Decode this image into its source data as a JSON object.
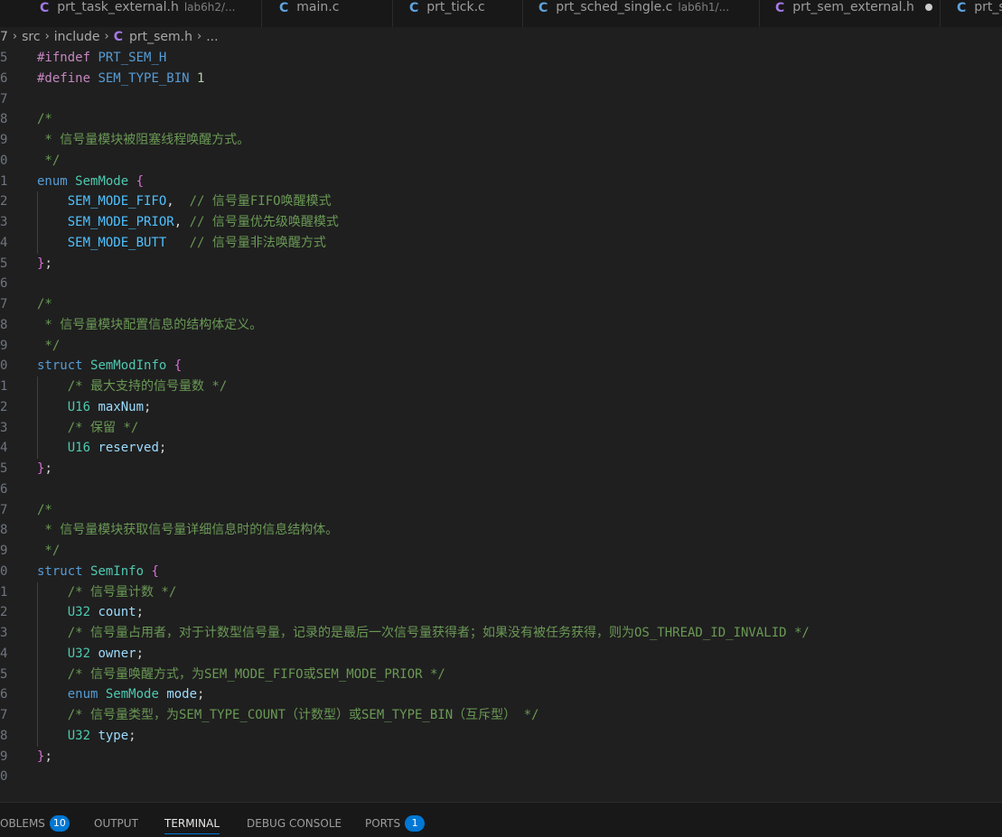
{
  "tabs": [
    {
      "icon": "C",
      "name": "prt_task_external.h",
      "desc": "lab6h2/...",
      "active": false
    },
    {
      "icon": "C",
      "name": "main.c",
      "desc": "",
      "active": false
    },
    {
      "icon": "C",
      "name": "prt_tick.c",
      "desc": "",
      "active": false
    },
    {
      "icon": "C",
      "name": "prt_sched_single.c",
      "desc": "lab6h1/...",
      "active": false
    },
    {
      "icon": "C",
      "name": "prt_sem_external.h",
      "desc": "",
      "active": true,
      "dirty": true
    },
    {
      "icon": "C",
      "name": "prt_s",
      "desc": "",
      "active": false
    }
  ],
  "breadcrumb": {
    "lead": "7",
    "items": [
      "src",
      "include"
    ],
    "file_icon": "C",
    "file": "prt_sem.h",
    "tail": "..."
  },
  "editor": {
    "lines": [
      {
        "num": "5",
        "html": "<span class=\"pp\">#ifndef</span> <span class=\"mac\">PRT_SEM_H</span>"
      },
      {
        "num": "6",
        "html": "<span class=\"pp\">#define</span> <span class=\"mac\">SEM_TYPE_BIN</span> <span class=\"nm\">1</span>"
      },
      {
        "num": "7",
        "html": ""
      },
      {
        "num": "8",
        "html": "<span class=\"cm\">/*</span>"
      },
      {
        "num": "9",
        "html": "<span class=\"cm\"> * 信号量模块被阻塞线程唤醒方式。</span>"
      },
      {
        "num": "0",
        "html": "<span class=\"cm\"> */</span>"
      },
      {
        "num": "1",
        "html": "<span class=\"kw\">enum</span> <span class=\"ty\">SemMode</span> <span class=\"br1\">{</span>"
      },
      {
        "num": "2",
        "html": "    <span class=\"en\">SEM_MODE_FIFO</span><span class=\"pn\">,</span>  <span class=\"cm\">// 信号量FIFO唤醒模式</span>"
      },
      {
        "num": "3",
        "html": "    <span class=\"en\">SEM_MODE_PRIOR</span><span class=\"pn\">,</span> <span class=\"cm\">// 信号量优先级唤醒模式</span>"
      },
      {
        "num": "4",
        "html": "    <span class=\"en\">SEM_MODE_BUTT</span>   <span class=\"cm\">// 信号量非法唤醒方式</span>"
      },
      {
        "num": "5",
        "html": "<span class=\"br1\">}</span><span class=\"pn\">;</span>"
      },
      {
        "num": "6",
        "html": ""
      },
      {
        "num": "7",
        "html": "<span class=\"cm\">/*</span>"
      },
      {
        "num": "8",
        "html": "<span class=\"cm\"> * 信号量模块配置信息的结构体定义。</span>"
      },
      {
        "num": "9",
        "html": "<span class=\"cm\"> */</span>"
      },
      {
        "num": "0",
        "html": "<span class=\"kw\">struct</span> <span class=\"ty\">SemModInfo</span> <span class=\"br1\">{</span>"
      },
      {
        "num": "1",
        "html": "    <span class=\"cm\">/* 最大支持的信号量数 */</span>"
      },
      {
        "num": "2",
        "html": "    <span class=\"ty\">U16</span> <span class=\"id\">maxNum</span><span class=\"pn\">;</span>"
      },
      {
        "num": "3",
        "html": "    <span class=\"cm\">/* 保留 */</span>"
      },
      {
        "num": "4",
        "html": "    <span class=\"ty\">U16</span> <span class=\"id\">reserved</span><span class=\"pn\">;</span>"
      },
      {
        "num": "5",
        "html": "<span class=\"br1\">}</span><span class=\"pn\">;</span>"
      },
      {
        "num": "6",
        "html": ""
      },
      {
        "num": "7",
        "html": "<span class=\"cm\">/*</span>"
      },
      {
        "num": "8",
        "html": "<span class=\"cm\"> * 信号量模块获取信号量详细信息时的信息结构体。</span>"
      },
      {
        "num": "9",
        "html": "<span class=\"cm\"> */</span>"
      },
      {
        "num": "0",
        "html": "<span class=\"kw\">struct</span> <span class=\"ty\">SemInfo</span> <span class=\"br1\">{</span>"
      },
      {
        "num": "1",
        "html": "    <span class=\"cm\">/* 信号量计数 */</span>"
      },
      {
        "num": "2",
        "html": "    <span class=\"ty\">U32</span> <span class=\"id\">count</span><span class=\"pn\">;</span>"
      },
      {
        "num": "3",
        "html": "    <span class=\"cm\">/* 信号量占用者，对于计数型信号量，记录的是最后一次信号量获得者；如果没有被任务获得，则为OS_THREAD_ID_INVALID */</span>"
      },
      {
        "num": "4",
        "html": "    <span class=\"ty\">U32</span> <span class=\"id\">owner</span><span class=\"pn\">;</span>"
      },
      {
        "num": "5",
        "html": "    <span class=\"cm\">/* 信号量唤醒方式，为SEM_MODE_FIFO或SEM_MODE_PRIOR */</span>"
      },
      {
        "num": "6",
        "html": "    <span class=\"kw\">enum</span> <span class=\"ty\">SemMode</span> <span class=\"id\">mode</span><span class=\"pn\">;</span>"
      },
      {
        "num": "7",
        "html": "    <span class=\"cm\">/* 信号量类型，为SEM_TYPE_COUNT（计数型）或SEM_TYPE_BIN（互斥型） */</span>"
      },
      {
        "num": "8",
        "html": "    <span class=\"ty\">U32</span> <span class=\"id\">type</span><span class=\"pn\">;</span>"
      },
      {
        "num": "9",
        "html": "<span class=\"br1\">}</span><span class=\"pn\">;</span>"
      },
      {
        "num": "0",
        "html": ""
      }
    ]
  },
  "panel": {
    "tabs": [
      {
        "label": "OBLEMS",
        "badge": "10",
        "active": false
      },
      {
        "label": "OUTPUT",
        "badge": "",
        "active": false
      },
      {
        "label": "TERMINAL",
        "badge": "",
        "active": true
      },
      {
        "label": "DEBUG CONSOLE",
        "badge": "",
        "active": false
      },
      {
        "label": "PORTS",
        "badge": "1",
        "active": false
      }
    ]
  },
  "colors": {
    "background": "#1f1f1f",
    "keyword": "#569cd6",
    "type": "#4ec9b0",
    "comment": "#6a9955",
    "accent": "#0078d4"
  }
}
